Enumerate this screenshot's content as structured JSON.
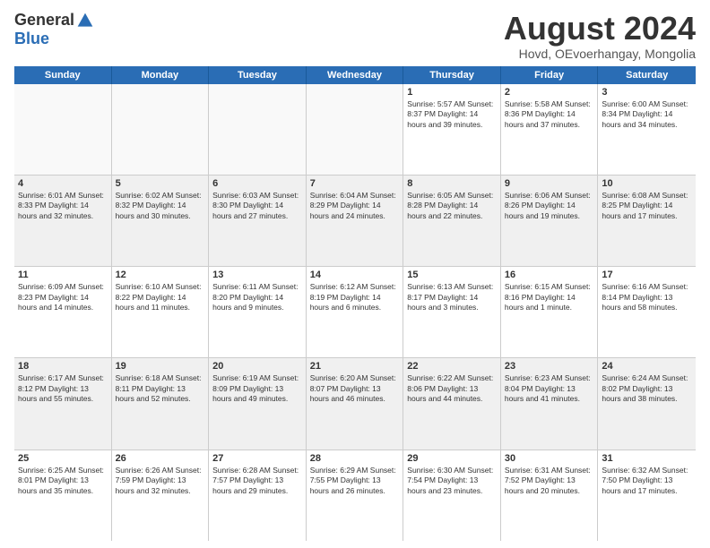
{
  "logo": {
    "general": "General",
    "blue": "Blue"
  },
  "title": "August 2024",
  "subtitle": "Hovd, OEvoerhangay, Mongolia",
  "headers": [
    "Sunday",
    "Monday",
    "Tuesday",
    "Wednesday",
    "Thursday",
    "Friday",
    "Saturday"
  ],
  "weeks": [
    [
      {
        "day": "",
        "text": "",
        "empty": true
      },
      {
        "day": "",
        "text": "",
        "empty": true
      },
      {
        "day": "",
        "text": "",
        "empty": true
      },
      {
        "day": "",
        "text": "",
        "empty": true
      },
      {
        "day": "1",
        "text": "Sunrise: 5:57 AM\nSunset: 8:37 PM\nDaylight: 14 hours\nand 39 minutes."
      },
      {
        "day": "2",
        "text": "Sunrise: 5:58 AM\nSunset: 8:36 PM\nDaylight: 14 hours\nand 37 minutes."
      },
      {
        "day": "3",
        "text": "Sunrise: 6:00 AM\nSunset: 8:34 PM\nDaylight: 14 hours\nand 34 minutes."
      }
    ],
    [
      {
        "day": "4",
        "text": "Sunrise: 6:01 AM\nSunset: 8:33 PM\nDaylight: 14 hours\nand 32 minutes."
      },
      {
        "day": "5",
        "text": "Sunrise: 6:02 AM\nSunset: 8:32 PM\nDaylight: 14 hours\nand 30 minutes."
      },
      {
        "day": "6",
        "text": "Sunrise: 6:03 AM\nSunset: 8:30 PM\nDaylight: 14 hours\nand 27 minutes."
      },
      {
        "day": "7",
        "text": "Sunrise: 6:04 AM\nSunset: 8:29 PM\nDaylight: 14 hours\nand 24 minutes."
      },
      {
        "day": "8",
        "text": "Sunrise: 6:05 AM\nSunset: 8:28 PM\nDaylight: 14 hours\nand 22 minutes."
      },
      {
        "day": "9",
        "text": "Sunrise: 6:06 AM\nSunset: 8:26 PM\nDaylight: 14 hours\nand 19 minutes."
      },
      {
        "day": "10",
        "text": "Sunrise: 6:08 AM\nSunset: 8:25 PM\nDaylight: 14 hours\nand 17 minutes."
      }
    ],
    [
      {
        "day": "11",
        "text": "Sunrise: 6:09 AM\nSunset: 8:23 PM\nDaylight: 14 hours\nand 14 minutes."
      },
      {
        "day": "12",
        "text": "Sunrise: 6:10 AM\nSunset: 8:22 PM\nDaylight: 14 hours\nand 11 minutes."
      },
      {
        "day": "13",
        "text": "Sunrise: 6:11 AM\nSunset: 8:20 PM\nDaylight: 14 hours\nand 9 minutes."
      },
      {
        "day": "14",
        "text": "Sunrise: 6:12 AM\nSunset: 8:19 PM\nDaylight: 14 hours\nand 6 minutes."
      },
      {
        "day": "15",
        "text": "Sunrise: 6:13 AM\nSunset: 8:17 PM\nDaylight: 14 hours\nand 3 minutes."
      },
      {
        "day": "16",
        "text": "Sunrise: 6:15 AM\nSunset: 8:16 PM\nDaylight: 14 hours\nand 1 minute."
      },
      {
        "day": "17",
        "text": "Sunrise: 6:16 AM\nSunset: 8:14 PM\nDaylight: 13 hours\nand 58 minutes."
      }
    ],
    [
      {
        "day": "18",
        "text": "Sunrise: 6:17 AM\nSunset: 8:12 PM\nDaylight: 13 hours\nand 55 minutes."
      },
      {
        "day": "19",
        "text": "Sunrise: 6:18 AM\nSunset: 8:11 PM\nDaylight: 13 hours\nand 52 minutes."
      },
      {
        "day": "20",
        "text": "Sunrise: 6:19 AM\nSunset: 8:09 PM\nDaylight: 13 hours\nand 49 minutes."
      },
      {
        "day": "21",
        "text": "Sunrise: 6:20 AM\nSunset: 8:07 PM\nDaylight: 13 hours\nand 46 minutes."
      },
      {
        "day": "22",
        "text": "Sunrise: 6:22 AM\nSunset: 8:06 PM\nDaylight: 13 hours\nand 44 minutes."
      },
      {
        "day": "23",
        "text": "Sunrise: 6:23 AM\nSunset: 8:04 PM\nDaylight: 13 hours\nand 41 minutes."
      },
      {
        "day": "24",
        "text": "Sunrise: 6:24 AM\nSunset: 8:02 PM\nDaylight: 13 hours\nand 38 minutes."
      }
    ],
    [
      {
        "day": "25",
        "text": "Sunrise: 6:25 AM\nSunset: 8:01 PM\nDaylight: 13 hours\nand 35 minutes."
      },
      {
        "day": "26",
        "text": "Sunrise: 6:26 AM\nSunset: 7:59 PM\nDaylight: 13 hours\nand 32 minutes."
      },
      {
        "day": "27",
        "text": "Sunrise: 6:28 AM\nSunset: 7:57 PM\nDaylight: 13 hours\nand 29 minutes."
      },
      {
        "day": "28",
        "text": "Sunrise: 6:29 AM\nSunset: 7:55 PM\nDaylight: 13 hours\nand 26 minutes."
      },
      {
        "day": "29",
        "text": "Sunrise: 6:30 AM\nSunset: 7:54 PM\nDaylight: 13 hours\nand 23 minutes."
      },
      {
        "day": "30",
        "text": "Sunrise: 6:31 AM\nSunset: 7:52 PM\nDaylight: 13 hours\nand 20 minutes."
      },
      {
        "day": "31",
        "text": "Sunrise: 6:32 AM\nSunset: 7:50 PM\nDaylight: 13 hours\nand 17 minutes."
      }
    ]
  ]
}
